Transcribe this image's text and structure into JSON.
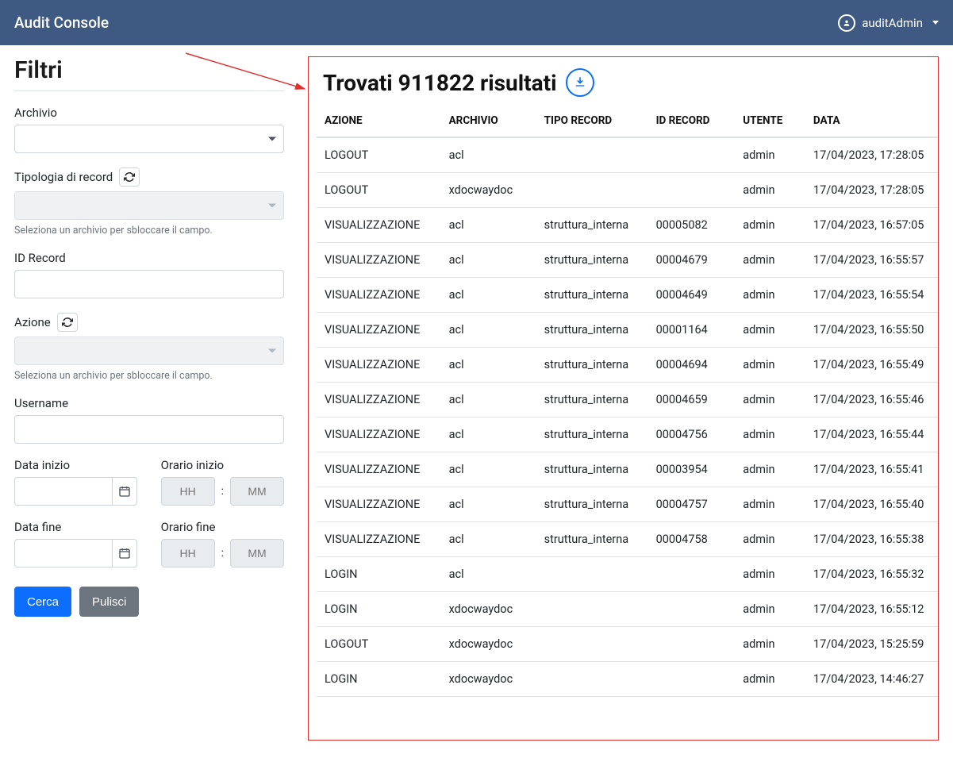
{
  "header": {
    "title": "Audit Console",
    "user": "auditAdmin"
  },
  "filters": {
    "title": "Filtri",
    "archivio_label": "Archivio",
    "tipologia_label": "Tipologia di record",
    "tipologia_help": "Seleziona un archivio per sbloccare il campo.",
    "idrecord_label": "ID Record",
    "azione_label": "Azione",
    "azione_help": "Seleziona un archivio per sbloccare il campo.",
    "username_label": "Username",
    "data_inizio_label": "Data inizio",
    "orario_inizio_label": "Orario inizio",
    "data_fine_label": "Data fine",
    "orario_fine_label": "Orario fine",
    "hh_placeholder": "HH",
    "mm_placeholder": "MM",
    "cerca_label": "Cerca",
    "pulisci_label": "Pulisci"
  },
  "results": {
    "title": "Trovati 911822 risultati",
    "columns": {
      "azione": "AZIONE",
      "archivio": "ARCHIVIO",
      "tipo": "TIPO RECORD",
      "id": "ID RECORD",
      "utente": "UTENTE",
      "data": "DATA"
    },
    "rows": [
      {
        "azione": "LOGOUT",
        "archivio": "acl",
        "tipo": "",
        "id": "",
        "utente": "admin",
        "data": "17/04/2023, 17:28:05"
      },
      {
        "azione": "LOGOUT",
        "archivio": "xdocwaydoc",
        "tipo": "",
        "id": "",
        "utente": "admin",
        "data": "17/04/2023, 17:28:05"
      },
      {
        "azione": "VISUALIZZAZIONE",
        "archivio": "acl",
        "tipo": "struttura_interna",
        "id": "00005082",
        "utente": "admin",
        "data": "17/04/2023, 16:57:05"
      },
      {
        "azione": "VISUALIZZAZIONE",
        "archivio": "acl",
        "tipo": "struttura_interna",
        "id": "00004679",
        "utente": "admin",
        "data": "17/04/2023, 16:55:57"
      },
      {
        "azione": "VISUALIZZAZIONE",
        "archivio": "acl",
        "tipo": "struttura_interna",
        "id": "00004649",
        "utente": "admin",
        "data": "17/04/2023, 16:55:54"
      },
      {
        "azione": "VISUALIZZAZIONE",
        "archivio": "acl",
        "tipo": "struttura_interna",
        "id": "00001164",
        "utente": "admin",
        "data": "17/04/2023, 16:55:50"
      },
      {
        "azione": "VISUALIZZAZIONE",
        "archivio": "acl",
        "tipo": "struttura_interna",
        "id": "00004694",
        "utente": "admin",
        "data": "17/04/2023, 16:55:49"
      },
      {
        "azione": "VISUALIZZAZIONE",
        "archivio": "acl",
        "tipo": "struttura_interna",
        "id": "00004659",
        "utente": "admin",
        "data": "17/04/2023, 16:55:46"
      },
      {
        "azione": "VISUALIZZAZIONE",
        "archivio": "acl",
        "tipo": "struttura_interna",
        "id": "00004756",
        "utente": "admin",
        "data": "17/04/2023, 16:55:44"
      },
      {
        "azione": "VISUALIZZAZIONE",
        "archivio": "acl",
        "tipo": "struttura_interna",
        "id": "00003954",
        "utente": "admin",
        "data": "17/04/2023, 16:55:41"
      },
      {
        "azione": "VISUALIZZAZIONE",
        "archivio": "acl",
        "tipo": "struttura_interna",
        "id": "00004757",
        "utente": "admin",
        "data": "17/04/2023, 16:55:40"
      },
      {
        "azione": "VISUALIZZAZIONE",
        "archivio": "acl",
        "tipo": "struttura_interna",
        "id": "00004758",
        "utente": "admin",
        "data": "17/04/2023, 16:55:38"
      },
      {
        "azione": "LOGIN",
        "archivio": "acl",
        "tipo": "",
        "id": "",
        "utente": "admin",
        "data": "17/04/2023, 16:55:32"
      },
      {
        "azione": "LOGIN",
        "archivio": "xdocwaydoc",
        "tipo": "",
        "id": "",
        "utente": "admin",
        "data": "17/04/2023, 16:55:12"
      },
      {
        "azione": "LOGOUT",
        "archivio": "xdocwaydoc",
        "tipo": "",
        "id": "",
        "utente": "admin",
        "data": "17/04/2023, 15:25:59"
      },
      {
        "azione": "LOGIN",
        "archivio": "xdocwaydoc",
        "tipo": "",
        "id": "",
        "utente": "admin",
        "data": "17/04/2023, 14:46:27"
      }
    ]
  }
}
